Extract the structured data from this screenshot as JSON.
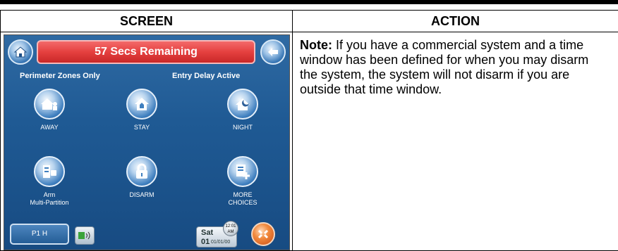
{
  "table": {
    "header_screen": "SCREEN",
    "header_action": "ACTION"
  },
  "note": {
    "label": "Note:",
    "text": " If you have a commercial system and a time window has been defined for when you may disarm the system, the system will not disarm if you are outside that time window."
  },
  "screen": {
    "banner": "57 Secs Remaining",
    "status_left": "Perimeter Zones Only",
    "status_right": "Entry Delay Active",
    "modes": [
      {
        "label": "AWAY"
      },
      {
        "label": "STAY"
      },
      {
        "label": "NIGHT"
      },
      {
        "label_line1": "Arm",
        "label_line2": "Multi-Partition"
      },
      {
        "label": "DISARM"
      },
      {
        "label_line1": "MORE",
        "label_line2": "CHOICES"
      }
    ],
    "partition_button": "P1 H",
    "day": "Sat",
    "date": "01",
    "date_small": "01/01/00",
    "clock_line1": "12:01",
    "clock_line2": "AM",
    "icons": {
      "home": "home-icon",
      "back": "back-arrow-icon",
      "chime": "chime-icon",
      "panic": "panic-icon"
    }
  }
}
